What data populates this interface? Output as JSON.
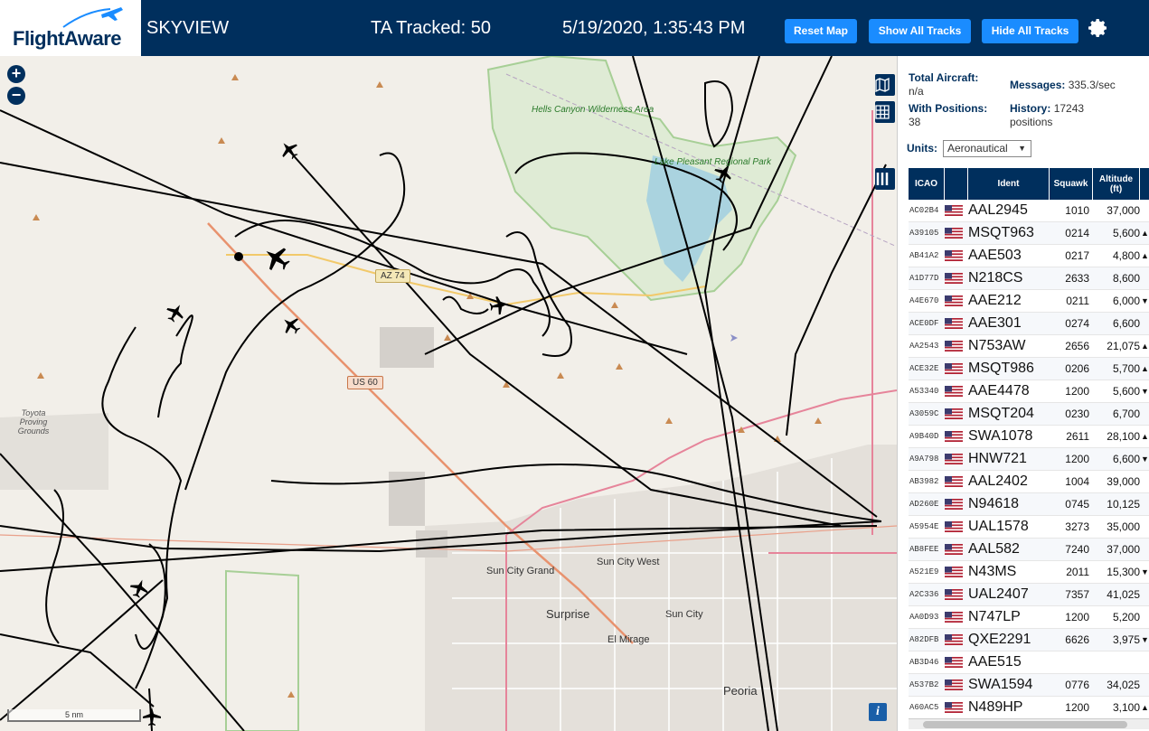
{
  "header": {
    "logo_text": "FlightAware",
    "app_title": "SKYVIEW",
    "tracked": "TA Tracked: 50",
    "datetime": "5/19/2020, 1:35:43 PM",
    "buttons": {
      "reset": "Reset Map",
      "show_all": "Show All Tracks",
      "hide_all": "Hide All Tracks"
    },
    "settings_icon": "gear-icon"
  },
  "map": {
    "zoom_in": "+",
    "zoom_out": "−",
    "scale_label": "5 nm",
    "info": "i",
    "labels": {
      "hells_canyon": "Hells Canyon Wilderness Area",
      "lake_pleasant": "Lake Pleasant Regional Park",
      "toyota": "Toyota Proving Grounds",
      "sun_city_grand": "Sun City Grand",
      "sun_city_west": "Sun City West",
      "surprise": "Surprise",
      "sun_city": "Sun City",
      "el_mirage": "El Mirage",
      "peoria": "Peoria"
    },
    "shields": {
      "az74": "AZ 74",
      "us60": "US 60"
    }
  },
  "sidebar": {
    "total_aircraft_label": "Total Aircraft:",
    "total_aircraft_value": "n/a",
    "with_positions_label": "With Positions:",
    "with_positions_value": "38",
    "messages_label": "Messages:",
    "messages_value": "335.3/sec",
    "history_label": "History:",
    "history_value": "17243",
    "history_unit": "positions",
    "units_label": "Units:",
    "units_value": "Aeronautical"
  },
  "table": {
    "headers": {
      "icao": "ICAO",
      "ident": "Ident",
      "squawk": "Squawk",
      "altitude": "Altitude (ft)"
    },
    "rows": [
      {
        "icao": "AC02B4",
        "ident": "AAL2945",
        "squawk": "1010",
        "alt": "37,000",
        "arrow": ""
      },
      {
        "icao": "A39105",
        "ident": "MSQT963",
        "squawk": "0214",
        "alt": "5,600",
        "arrow": "▲"
      },
      {
        "icao": "AB41A2",
        "ident": "AAE503",
        "squawk": "0217",
        "alt": "4,800",
        "arrow": "▲"
      },
      {
        "icao": "A1D77D",
        "ident": "N218CS",
        "squawk": "2633",
        "alt": "8,600",
        "arrow": ""
      },
      {
        "icao": "A4E670",
        "ident": "AAE212",
        "squawk": "0211",
        "alt": "6,000",
        "arrow": "▼"
      },
      {
        "icao": "ACE0DF",
        "ident": "AAE301",
        "squawk": "0274",
        "alt": "6,600",
        "arrow": ""
      },
      {
        "icao": "AA2543",
        "ident": "N753AW",
        "squawk": "2656",
        "alt": "21,075",
        "arrow": "▲"
      },
      {
        "icao": "ACE32E",
        "ident": "MSQT986",
        "squawk": "0206",
        "alt": "5,700",
        "arrow": "▲"
      },
      {
        "icao": "A53340",
        "ident": "AAE4478",
        "squawk": "1200",
        "alt": "5,600",
        "arrow": "▼"
      },
      {
        "icao": "A3059C",
        "ident": "MSQT204",
        "squawk": "0230",
        "alt": "6,700",
        "arrow": ""
      },
      {
        "icao": "A9B40D",
        "ident": "SWA1078",
        "squawk": "2611",
        "alt": "28,100",
        "arrow": "▲"
      },
      {
        "icao": "A9A798",
        "ident": "HNW721",
        "squawk": "1200",
        "alt": "6,600",
        "arrow": "▼"
      },
      {
        "icao": "AB3982",
        "ident": "AAL2402",
        "squawk": "1004",
        "alt": "39,000",
        "arrow": ""
      },
      {
        "icao": "AD260E",
        "ident": "N94618",
        "squawk": "0745",
        "alt": "10,125",
        "arrow": ""
      },
      {
        "icao": "A5954E",
        "ident": "UAL1578",
        "squawk": "3273",
        "alt": "35,000",
        "arrow": ""
      },
      {
        "icao": "AB8FEE",
        "ident": "AAL582",
        "squawk": "7240",
        "alt": "37,000",
        "arrow": ""
      },
      {
        "icao": "A521E9",
        "ident": "N43MS",
        "squawk": "2011",
        "alt": "15,300",
        "arrow": "▼"
      },
      {
        "icao": "A2C336",
        "ident": "UAL2407",
        "squawk": "7357",
        "alt": "41,025",
        "arrow": ""
      },
      {
        "icao": "AA0D93",
        "ident": "N747LP",
        "squawk": "1200",
        "alt": "5,200",
        "arrow": ""
      },
      {
        "icao": "A82DFB",
        "ident": "QXE2291",
        "squawk": "6626",
        "alt": "3,975",
        "arrow": "▼"
      },
      {
        "icao": "AB3D46",
        "ident": "AAE515",
        "squawk": "",
        "alt": "",
        "arrow": ""
      },
      {
        "icao": "A537B2",
        "ident": "SWA1594",
        "squawk": "0776",
        "alt": "34,025",
        "arrow": ""
      },
      {
        "icao": "A60AC5",
        "ident": "N489HP",
        "squawk": "1200",
        "alt": "3,100",
        "arrow": "▲"
      }
    ]
  },
  "colors": {
    "header_bg": "#002f5d",
    "button_bg": "#1a8cff",
    "map_bg": "#f2efe9"
  }
}
